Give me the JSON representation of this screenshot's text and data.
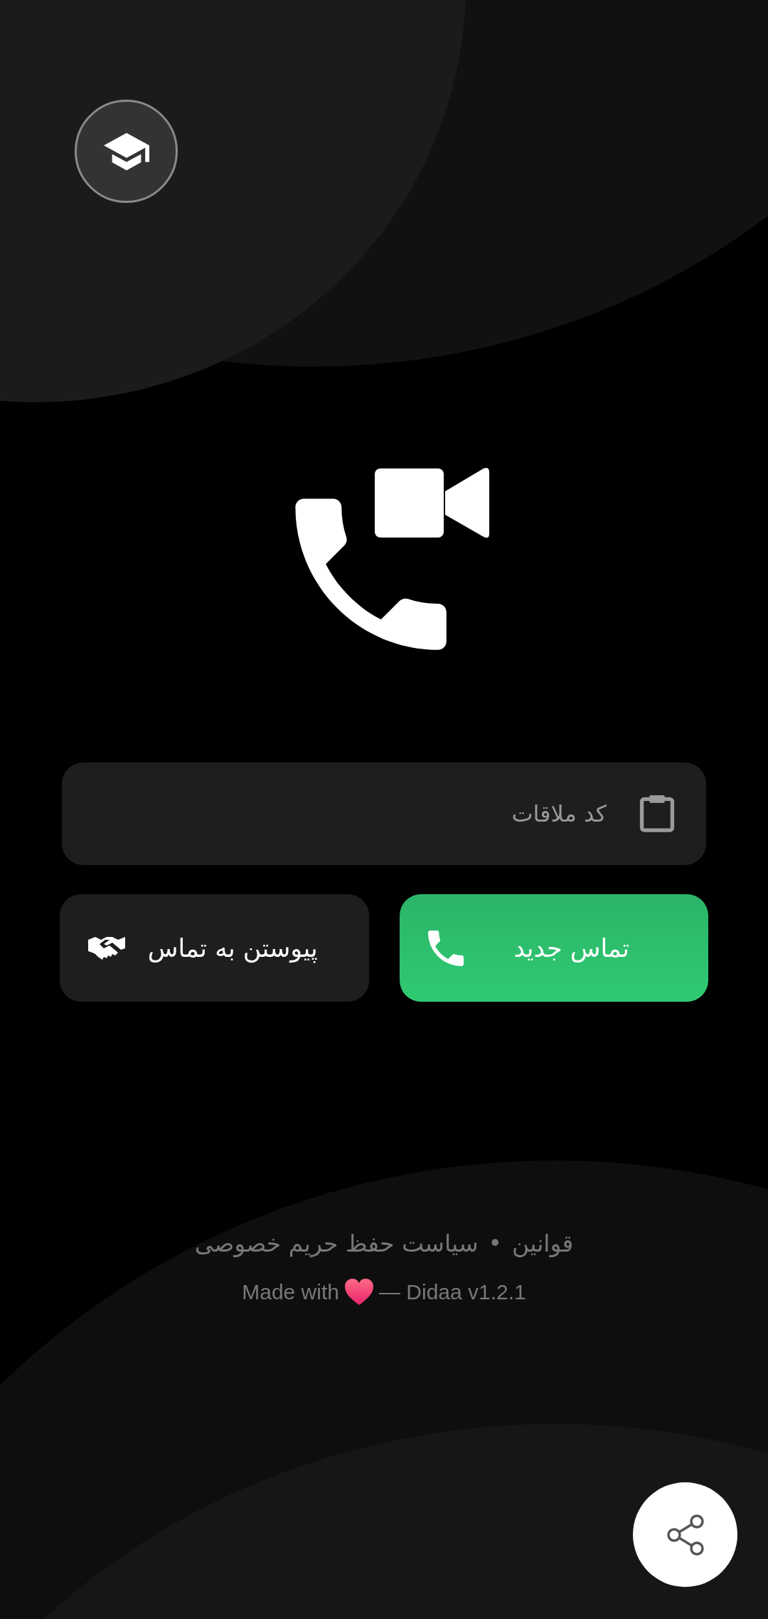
{
  "meeting_code": {
    "placeholder": "کد ملاقات"
  },
  "buttons": [
    {
      "kind": "primary",
      "label": "تماس جدید"
    },
    {
      "kind": "secondary",
      "label": "پیوستن به تماس"
    }
  ],
  "footer": {
    "links": [
      "قوانین",
      "سیاست حفظ حریم خصوصی"
    ],
    "separator": "•",
    "credit_before": "Made with",
    "credit_after": "— Didaa v1.2.1"
  }
}
